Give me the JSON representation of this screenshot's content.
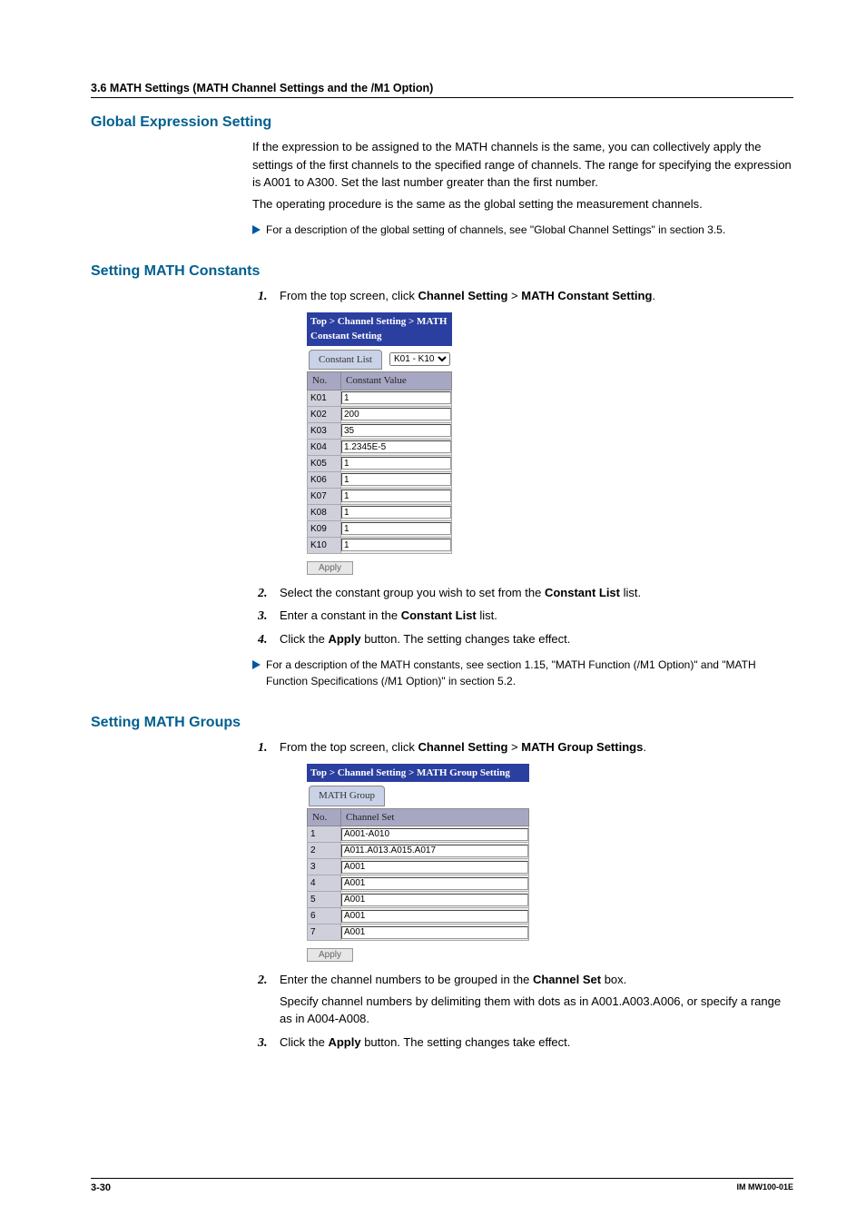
{
  "header": "3.6  MATH Settings (MATH Channel Settings and the /M1 Option)",
  "section_global": {
    "title": "Global Expression Setting",
    "para1": "If the expression to be assigned to the MATH channels is the same, you can collectively apply the settings of the first channels to the specified range of channels. The range for specifying the expression is A001 to A300. Set the last number greater than the first number.",
    "para2": "The operating procedure is the same as the global setting the measurement channels.",
    "note": "For a description of the global setting of channels, see \"Global Channel Settings\" in section 3.5."
  },
  "section_constants": {
    "title": "Setting MATH Constants",
    "step1_a": "From the top screen, click ",
    "step1_b": "Channel Setting",
    "step1_c": " > ",
    "step1_d": "MATH Constant Setting",
    "step1_e": ".",
    "step2_a": "Select the constant group you wish to set from the ",
    "step2_b": "Constant List",
    "step2_c": " list.",
    "step3_a": "Enter a constant in the ",
    "step3_b": "Constant List",
    "step3_c": " list.",
    "step4_a": "Click the ",
    "step4_b": "Apply",
    "step4_c": " button. The setting changes take effect.",
    "note": "For a description of the MATH constants, see section 1.15, \"MATH Function (/M1 Option)\" and \"MATH Function Specifications (/M1 Option)\" in section 5.2.",
    "ss": {
      "breadcrumb": "Top > Channel Setting > MATH Constant Setting",
      "tab": "Constant List",
      "select": "K01 - K10",
      "col_no": "No.",
      "col_val": "Constant Value",
      "apply": "Apply",
      "rows": [
        {
          "no": "K01",
          "val": "1"
        },
        {
          "no": "K02",
          "val": "200"
        },
        {
          "no": "K03",
          "val": "35"
        },
        {
          "no": "K04",
          "val": "1.2345E-5"
        },
        {
          "no": "K05",
          "val": "1"
        },
        {
          "no": "K06",
          "val": "1"
        },
        {
          "no": "K07",
          "val": "1"
        },
        {
          "no": "K08",
          "val": "1"
        },
        {
          "no": "K09",
          "val": "1"
        },
        {
          "no": "K10",
          "val": "1"
        }
      ]
    }
  },
  "section_groups": {
    "title": "Setting MATH Groups",
    "step1_a": "From the top screen, click ",
    "step1_b": "Channel Setting",
    "step1_c": " > ",
    "step1_d": "MATH Group Settings",
    "step1_e": ".",
    "step2_a": "Enter the channel numbers to be grouped in the ",
    "step2_b": "Channel Set",
    "step2_c": " box.",
    "step2_p2": "Specify channel numbers by delimiting them with dots as in A001.A003.A006, or specify a range as in A004-A008.",
    "step3_a": "Click the ",
    "step3_b": "Apply",
    "step3_c": " button. The setting changes take effect.",
    "ss": {
      "breadcrumb": "Top > Channel Setting > MATH Group Setting",
      "tab": "MATH Group",
      "col_no": "No.",
      "col_ch": "Channel Set",
      "apply": "Apply",
      "rows": [
        {
          "no": "1",
          "val": "A001-A010"
        },
        {
          "no": "2",
          "val": "A011.A013.A015.A017"
        },
        {
          "no": "3",
          "val": "A001"
        },
        {
          "no": "4",
          "val": "A001"
        },
        {
          "no": "5",
          "val": "A001"
        },
        {
          "no": "6",
          "val": "A001"
        },
        {
          "no": "7",
          "val": "A001"
        }
      ]
    }
  },
  "footer": {
    "page": "3-30",
    "docid": "IM MW100-01E"
  }
}
